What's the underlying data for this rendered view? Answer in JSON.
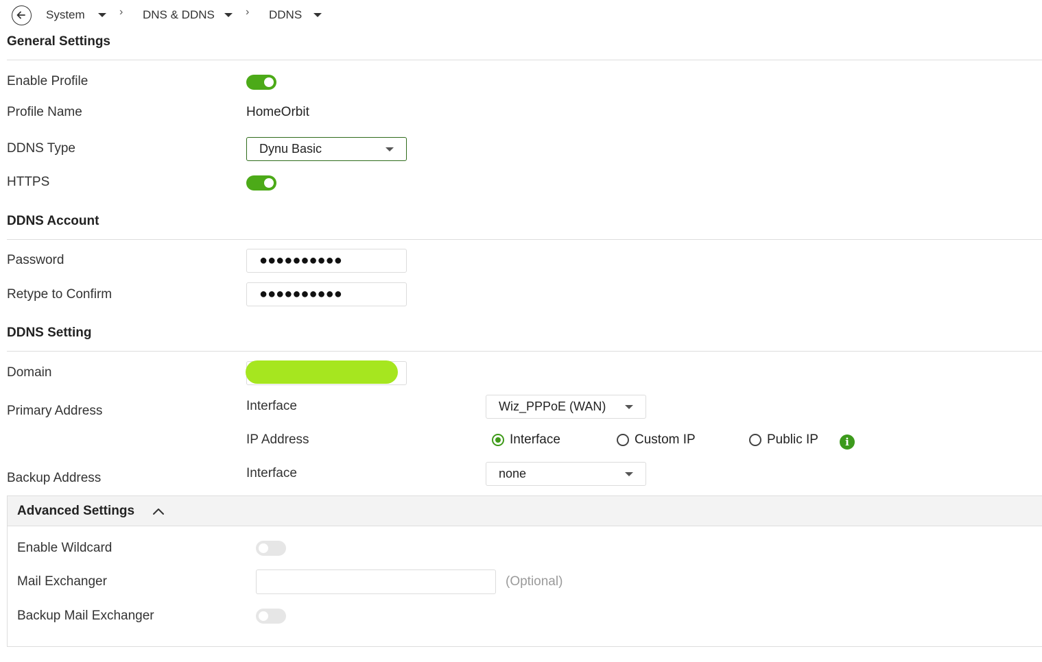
{
  "breadcrumb": {
    "items": [
      {
        "label": "System"
      },
      {
        "label": "DNS & DDNS"
      },
      {
        "label": "DDNS"
      }
    ]
  },
  "general": {
    "title": "General Settings",
    "enable_profile": {
      "label": "Enable Profile",
      "on": true
    },
    "profile_name": {
      "label": "Profile Name",
      "value": "HomeOrbit"
    },
    "ddns_type": {
      "label": "DDNS Type",
      "value": "Dynu Basic"
    },
    "https": {
      "label": "HTTPS",
      "on": true
    }
  },
  "account": {
    "title": "DDNS Account",
    "password": {
      "label": "Password",
      "value": "●●●●●●●●●●"
    },
    "retype": {
      "label": "Retype to Confirm",
      "value": "●●●●●●●●●●"
    }
  },
  "setting": {
    "title": "DDNS Setting",
    "domain": {
      "label": "Domain",
      "value": ""
    },
    "primary": {
      "label": "Primary Address",
      "interface_label": "Interface",
      "interface_value": "Wiz_PPPoE (WAN)",
      "ip_label": "IP Address",
      "options": [
        {
          "label": "Interface",
          "checked": true
        },
        {
          "label": "Custom IP",
          "checked": false
        },
        {
          "label": "Public IP",
          "checked": false
        }
      ]
    },
    "backup": {
      "label": "Backup Address",
      "interface_label": "Interface",
      "interface_value": "none"
    }
  },
  "advanced": {
    "title": "Advanced Settings",
    "enable_wildcard": {
      "label": "Enable Wildcard",
      "on": false
    },
    "mail_exchanger": {
      "label": "Mail Exchanger",
      "value": "",
      "hint": "(Optional)"
    },
    "backup_mail": {
      "label": "Backup Mail Exchanger",
      "on": false
    }
  },
  "colors": {
    "accent_green": "#4caa18",
    "redaction_highlight": "#a6e61f"
  },
  "icons": [
    "back-arrow-icon",
    "caret-down-icon",
    "chevron-right-icon",
    "info-icon",
    "chevron-up-icon"
  ]
}
